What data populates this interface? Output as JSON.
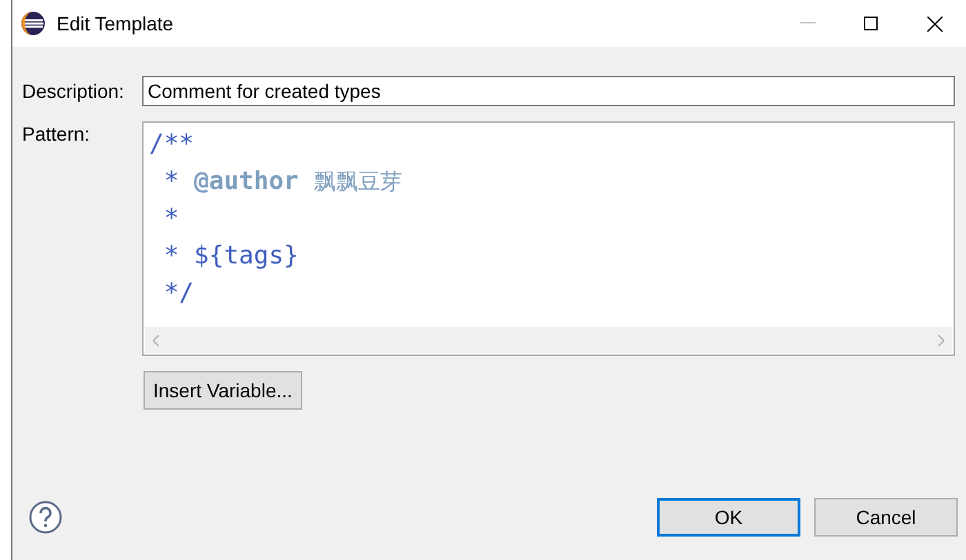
{
  "window": {
    "title": "Edit Template"
  },
  "description": {
    "label": "Description:",
    "value": "Comment for created types"
  },
  "pattern": {
    "label": "Pattern:",
    "lines": [
      [
        {
          "kind": "comment",
          "text": "/**"
        }
      ],
      [
        {
          "kind": "comment",
          "text": " * "
        },
        {
          "kind": "tag",
          "text": "@author"
        },
        {
          "kind": "name",
          "text": "飘飘豆芽"
        }
      ],
      [
        {
          "kind": "comment",
          "text": " *"
        }
      ],
      [
        {
          "kind": "comment",
          "text": " * "
        },
        {
          "kind": "variable",
          "text": "${tags}"
        }
      ],
      [
        {
          "kind": "comment",
          "text": " */"
        }
      ]
    ]
  },
  "insert_variable": {
    "label": "Insert Variable..."
  },
  "buttons": [
    {
      "label": "OK",
      "default": true
    },
    {
      "label": "Cancel",
      "default": false
    }
  ]
}
